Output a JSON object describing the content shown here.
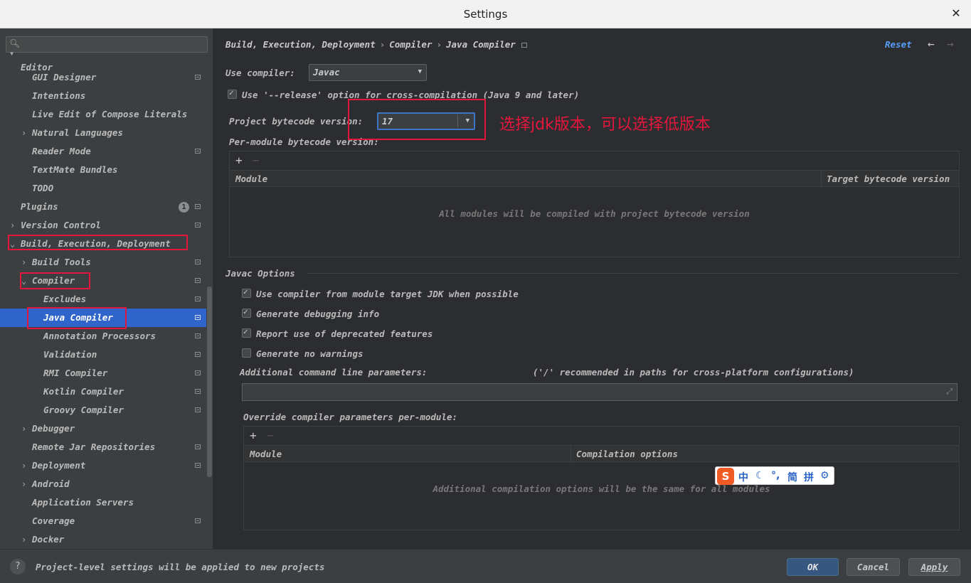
{
  "window": {
    "title": "Settings",
    "close_icon": "close-icon"
  },
  "sidebar": {
    "search_placeholder": "",
    "items": [
      {
        "label": "Editor"
      },
      {
        "label": "GUI Designer"
      },
      {
        "label": "Intentions"
      },
      {
        "label": "Live Edit of Compose Literals"
      },
      {
        "label": "Natural Languages"
      },
      {
        "label": "Reader Mode"
      },
      {
        "label": "TextMate Bundles"
      },
      {
        "label": "TODO"
      },
      {
        "label": "Plugins",
        "badge": "1"
      },
      {
        "label": "Version Control"
      },
      {
        "label": "Build, Execution, Deployment"
      },
      {
        "label": "Build Tools"
      },
      {
        "label": "Compiler"
      },
      {
        "label": "Excludes"
      },
      {
        "label": "Java Compiler"
      },
      {
        "label": "Annotation Processors"
      },
      {
        "label": "Validation"
      },
      {
        "label": "RMI Compiler"
      },
      {
        "label": "Kotlin Compiler"
      },
      {
        "label": "Groovy Compiler"
      },
      {
        "label": "Debugger"
      },
      {
        "label": "Remote Jar Repositories"
      },
      {
        "label": "Deployment"
      },
      {
        "label": "Android"
      },
      {
        "label": "Application Servers"
      },
      {
        "label": "Coverage"
      },
      {
        "label": "Docker"
      }
    ]
  },
  "main": {
    "breadcrumb": [
      "Build, Execution, Deployment",
      "Compiler",
      "Java Compiler"
    ],
    "reset_label": "Reset",
    "use_compiler_label": "Use compiler:",
    "use_compiler_value": "Javac",
    "release_option_label": "Use '--release' option for cross-compilation (Java 9 and later)",
    "bytecode_label": "Project bytecode version:",
    "bytecode_value": "17",
    "per_module_label": "Per-module bytecode version:",
    "module_table": {
      "col_module": "Module",
      "col_target": "Target bytecode version",
      "empty_text": "All modules will be compiled with project bytecode version"
    },
    "javac_options_title": "Javac Options",
    "options": [
      {
        "label": "Use compiler from module target JDK when possible",
        "checked": true
      },
      {
        "label": "Generate debugging info",
        "checked": true
      },
      {
        "label": "Report use of deprecated features",
        "checked": true
      },
      {
        "label": "Generate no warnings",
        "checked": false
      }
    ],
    "additional_params_label": "Additional command line parameters:",
    "additional_params_hint": "('/' recommended in paths for cross-platform configurations)",
    "additional_params_value": "",
    "override_label": "Override compiler parameters per-module:",
    "override_table": {
      "col_module": "Module",
      "col_options": "Compilation options",
      "empty_text": "Additional compilation options will be the same for all modules"
    }
  },
  "annotation": "选择jdk版本，可以选择低版本",
  "ime_toolbar": {
    "logo": "S",
    "items": [
      "中",
      "☾",
      "°,",
      "简",
      "拼",
      "⚙"
    ]
  },
  "footer": {
    "note": "Project-level settings will be applied to new projects",
    "ok": "OK",
    "cancel": "Cancel",
    "apply": "Apply"
  },
  "colors": {
    "selection": "#2f65ca",
    "link": "#589df6",
    "annotation": "#e5163b",
    "primary_button": "#365880"
  }
}
